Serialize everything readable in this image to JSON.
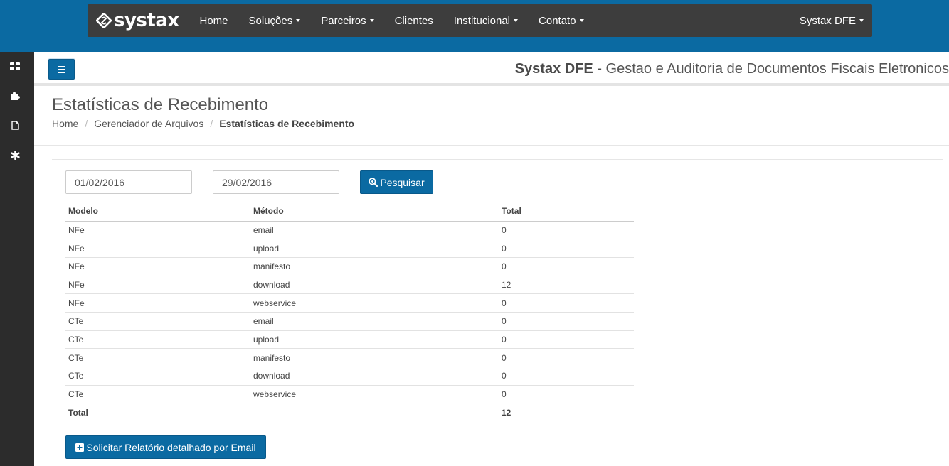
{
  "navbar": {
    "brand": "systax",
    "items": [
      {
        "label": "Home",
        "dropdown": false
      },
      {
        "label": "Soluções",
        "dropdown": true
      },
      {
        "label": "Parceiros",
        "dropdown": true
      },
      {
        "label": "Clientes",
        "dropdown": false
      },
      {
        "label": "Institucional",
        "dropdown": true
      },
      {
        "label": "Contato",
        "dropdown": true
      }
    ],
    "right_label": "Systax DFE"
  },
  "sidebar": {
    "icons": [
      "dashboard-icon",
      "puzzle-icon",
      "file-icon",
      "asterisk-icon"
    ]
  },
  "header": {
    "title_bold": "Systax DFE -",
    "title_rest": " Gestao e Auditoria de Documentos Fiscais Eletronicos"
  },
  "page": {
    "title": "Estatísticas de Recebimento",
    "breadcrumb": [
      "Home",
      "Gerenciador de Arquivos",
      "Estatísticas de Recebimento"
    ]
  },
  "form": {
    "date_start": "01/02/2016",
    "date_end": "29/02/2016",
    "search_label": "Pesquisar"
  },
  "table": {
    "headers": [
      "Modelo",
      "Método",
      "Total"
    ],
    "rows": [
      [
        "NFe",
        "email",
        "0"
      ],
      [
        "NFe",
        "upload",
        "0"
      ],
      [
        "NFe",
        "manifesto",
        "0"
      ],
      [
        "NFe",
        "download",
        "12"
      ],
      [
        "NFe",
        "webservice",
        "0"
      ],
      [
        "CTe",
        "email",
        "0"
      ],
      [
        "CTe",
        "upload",
        "0"
      ],
      [
        "CTe",
        "manifesto",
        "0"
      ],
      [
        "CTe",
        "download",
        "0"
      ],
      [
        "CTe",
        "webservice",
        "0"
      ]
    ],
    "total_label": "Total",
    "total_value": "12"
  },
  "report_button_label": "Solicitar Relatório detalhado por Email",
  "colors": {
    "primary": "#0b6aa2",
    "navbar": "#3d3d3d",
    "sidebar": "#2c2c2c"
  }
}
